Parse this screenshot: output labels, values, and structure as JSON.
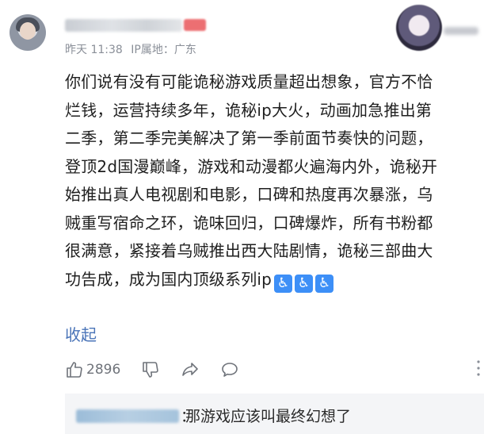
{
  "comment": {
    "time": "昨天 11:38",
    "ip_location": "IP属地：广东",
    "lines": [
      "你们说有没有可能诡秘游戏质量超出想象，官方不恰",
      "烂钱，运营持续多年，诡秘ip大火，动画加急推出第",
      "二季，第二季完美解决了第一季前面节奏快的问题，",
      "登顶2d国漫巅峰，游戏和动漫都火遍海内外，诡秘开",
      "始推出真人电视剧和电影，口碑和热度再次暴涨，乌",
      "贼重写宿命之环，诡味回归，口碑爆炸，所有书粉都",
      "很满意，紧接着乌贼推出西大陆剧情，诡秘三部曲大",
      "功告成，成为国内顶级系列ip"
    ],
    "emoji": "♿",
    "emoji_count": 3,
    "collapse_label": "收起",
    "like_count": "2896"
  },
  "reply": {
    "colon": "：",
    "text": "那游戏应该叫最终幻想了"
  },
  "colors": {
    "link": "#4a74b8",
    "meta": "#8a8f98",
    "reply_bg": "#f4f5f7",
    "emoji_bg": "#3d8ff7"
  },
  "icons": [
    "thumbs-up-icon",
    "thumbs-down-icon",
    "share-icon",
    "comment-icon",
    "more-icon"
  ]
}
